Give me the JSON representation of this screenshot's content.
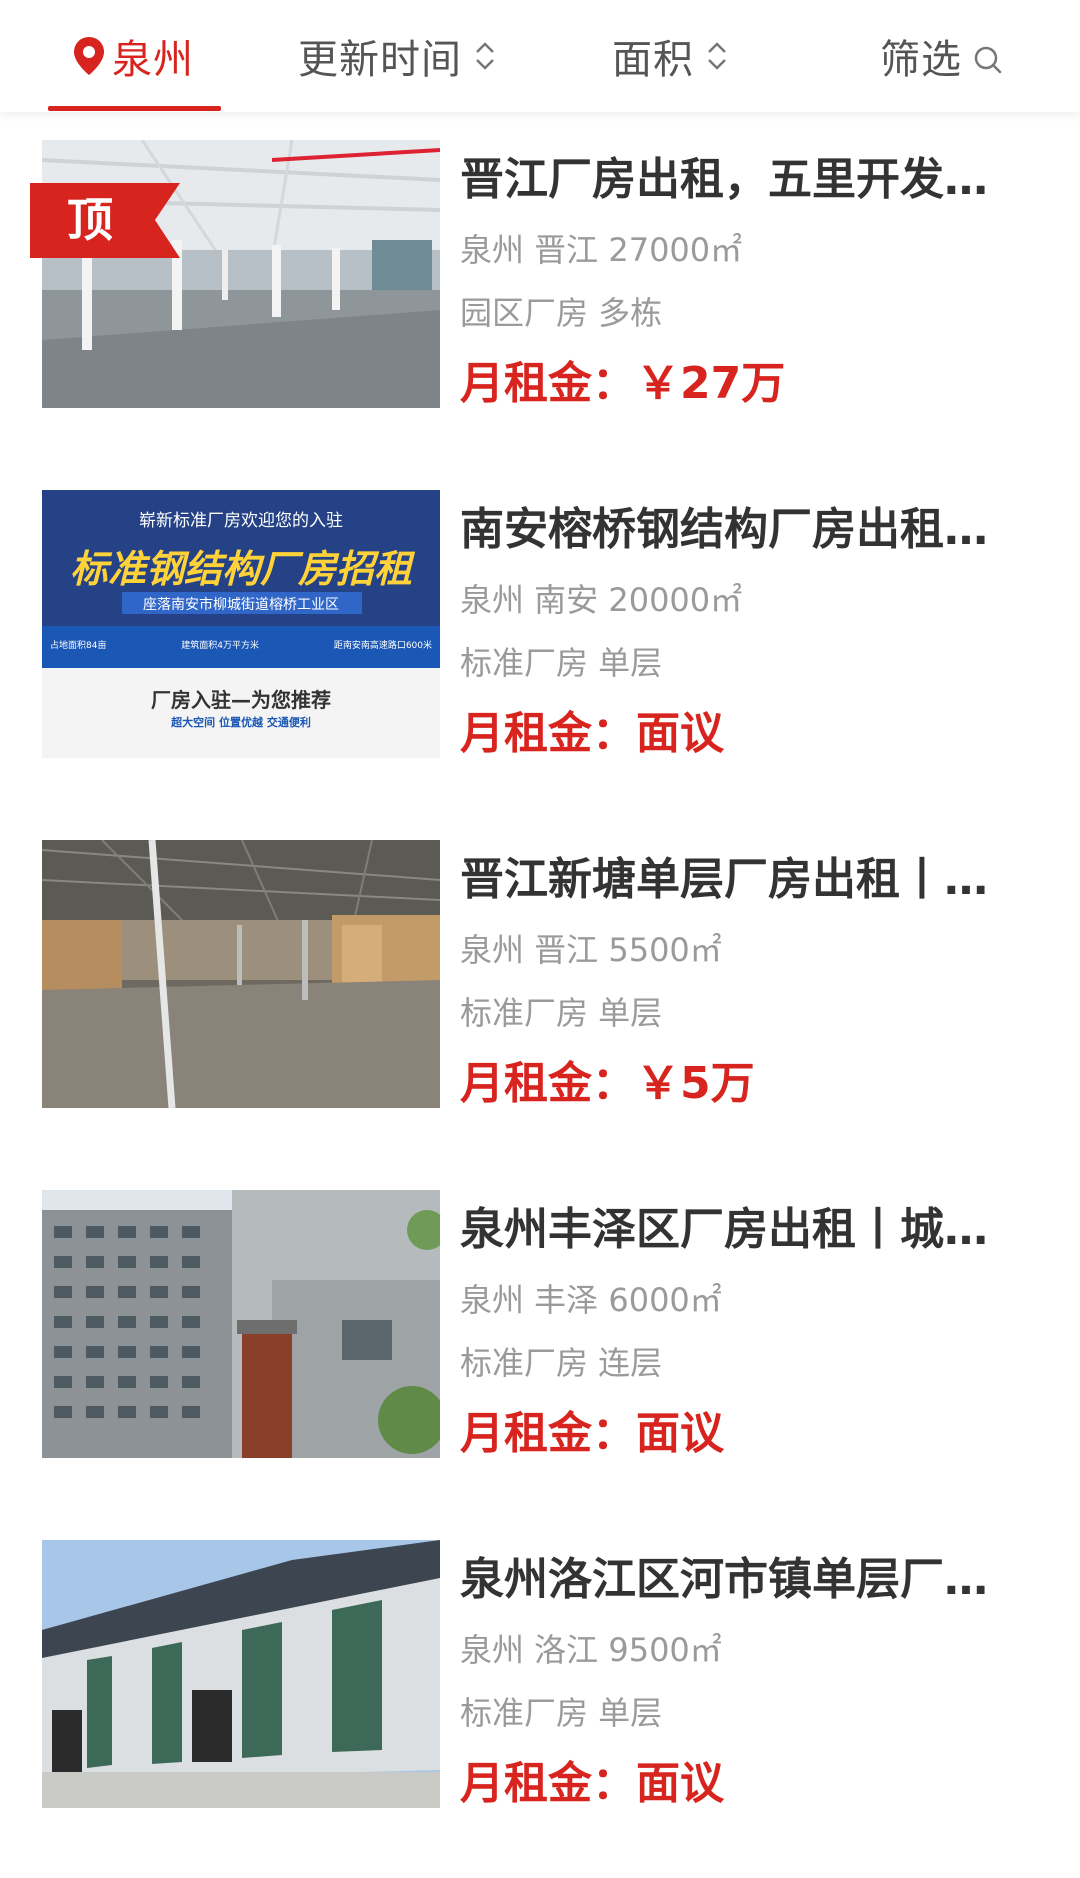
{
  "filters": {
    "city": "泉州",
    "update_time": "更新时间",
    "area": "面积",
    "screen": "筛选"
  },
  "top_badge": "顶",
  "listings": [
    {
      "title": "晋江厂房出租，五里开发…",
      "location": "泉州 晋江 27000㎡",
      "tags": "园区厂房 多栋",
      "price": "月租金：￥27万",
      "image": "interior of multi-storey factory floor"
    },
    {
      "title": "南安榕桥钢结构厂房出租…",
      "location": "泉州 南安 20000㎡",
      "tags": "标准厂房 单层",
      "price": "月租金：面议",
      "banner": {
        "line1": "崭新标准厂房欢迎您的入驻",
        "line2": "标准钢结构厂房招租",
        "line3": "座落南安市柳城街道榕桥工业区",
        "check1": "占地面积84亩",
        "check2": "建筑面积4万平方米",
        "check3": "距南安南高速路口600米",
        "line4": "厂房入驻—为您推荐",
        "line5": "超大空间  位置优越  交通便利"
      }
    },
    {
      "title": "晋江新塘单层厂房出租丨…",
      "location": "泉州 晋江 5500㎡",
      "tags": "标准厂房 单层",
      "price": "月租金：￥5万",
      "image": "single-storey steel factory interior"
    },
    {
      "title": "泉州丰泽区厂房出租丨城…",
      "location": "泉州 丰泽 6000㎡",
      "tags": "标准厂房 连层",
      "price": "月租金：面议",
      "image": "multi-storey factory buildings exterior"
    },
    {
      "title": "泉州洛江区河市镇单层厂…",
      "location": "泉州 洛江 9500㎡",
      "tags": "标准厂房 单层",
      "price": "月租金：面议",
      "image": "single-storey factory exterior"
    }
  ],
  "colors": {
    "accent": "#d8241f",
    "text": "#333333",
    "muted": "#9a9a9a"
  }
}
